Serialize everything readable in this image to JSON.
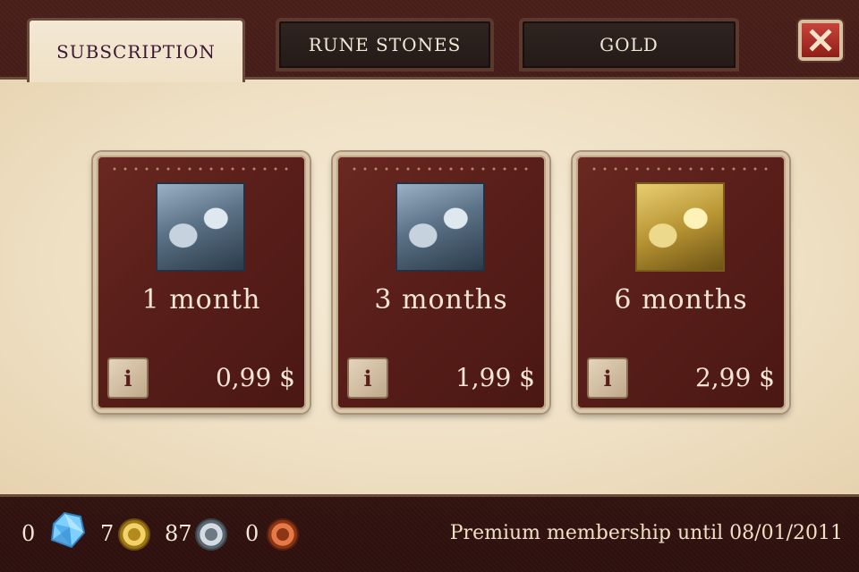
{
  "tabs": [
    {
      "label": "SUBSCRIPTION",
      "active": true
    },
    {
      "label": "RUNE STONES",
      "active": false
    },
    {
      "label": "GOLD",
      "active": false
    }
  ],
  "close_icon": "close-x-icon",
  "cards": [
    {
      "duration": "1 month",
      "price": "0,99 $",
      "portrait": "silver",
      "info_label": "i"
    },
    {
      "duration": "3 months",
      "price": "1,99 $",
      "portrait": "silver",
      "info_label": "i"
    },
    {
      "duration": "6 months",
      "price": "2,99 $",
      "portrait": "gold",
      "info_label": "i"
    }
  ],
  "currencies": {
    "crystals": "0",
    "gold": "7",
    "silver": "87",
    "copper": "0"
  },
  "premium_text": "Premium membership until 08/01/2011",
  "colors": {
    "leather": "#4a1f1a",
    "parchment": "#efe1c6",
    "active_tab_text": "#3e1736",
    "close_button": "#b3342b"
  }
}
